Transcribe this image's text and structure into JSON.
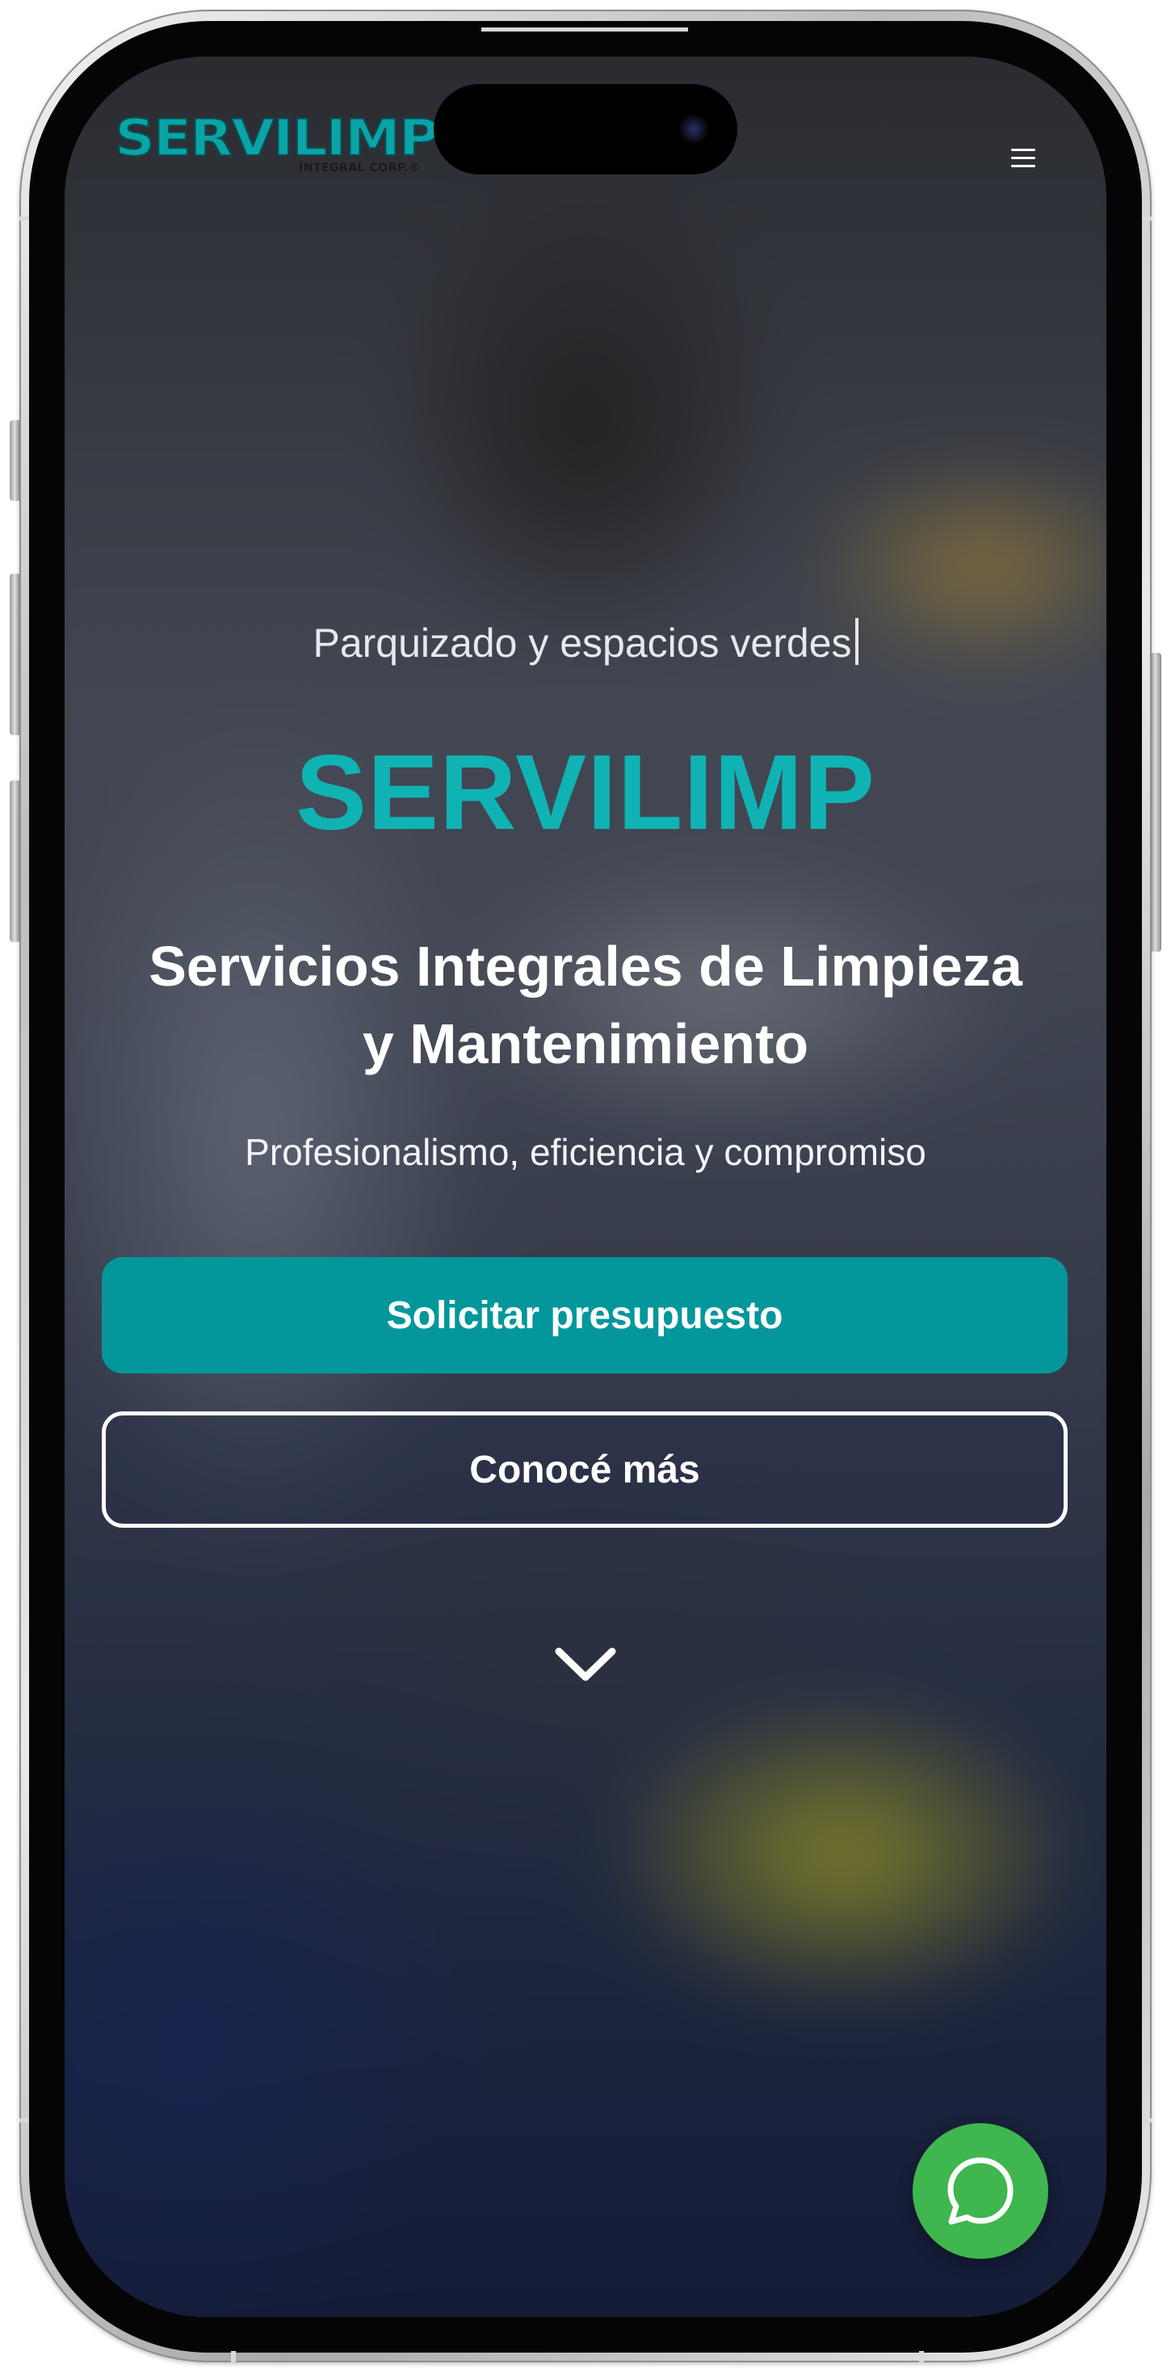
{
  "header": {
    "logo_text": "SERVILIMP",
    "logo_subtext": "INTEGRAL CORP.®"
  },
  "hero": {
    "typed_text": "Parquizado y espacios verdes",
    "brand_title": "SERVILIMP",
    "headline": "Servicios Integrales de Limpieza y Mantenimiento",
    "tagline": "Profesionalismo, eficiencia y compromiso",
    "primary_cta_label": "Solicitar presupuesto",
    "secondary_cta_label": "Conocé más"
  },
  "icons": {
    "menu": "hamburger-menu-icon",
    "scroll": "chevron-down-icon",
    "chat": "whatsapp-icon"
  },
  "colors": {
    "brand_teal": "#0fb3b3",
    "button_teal": "#03979b",
    "whatsapp_green": "#3fb64e",
    "text_white": "#ffffff"
  }
}
